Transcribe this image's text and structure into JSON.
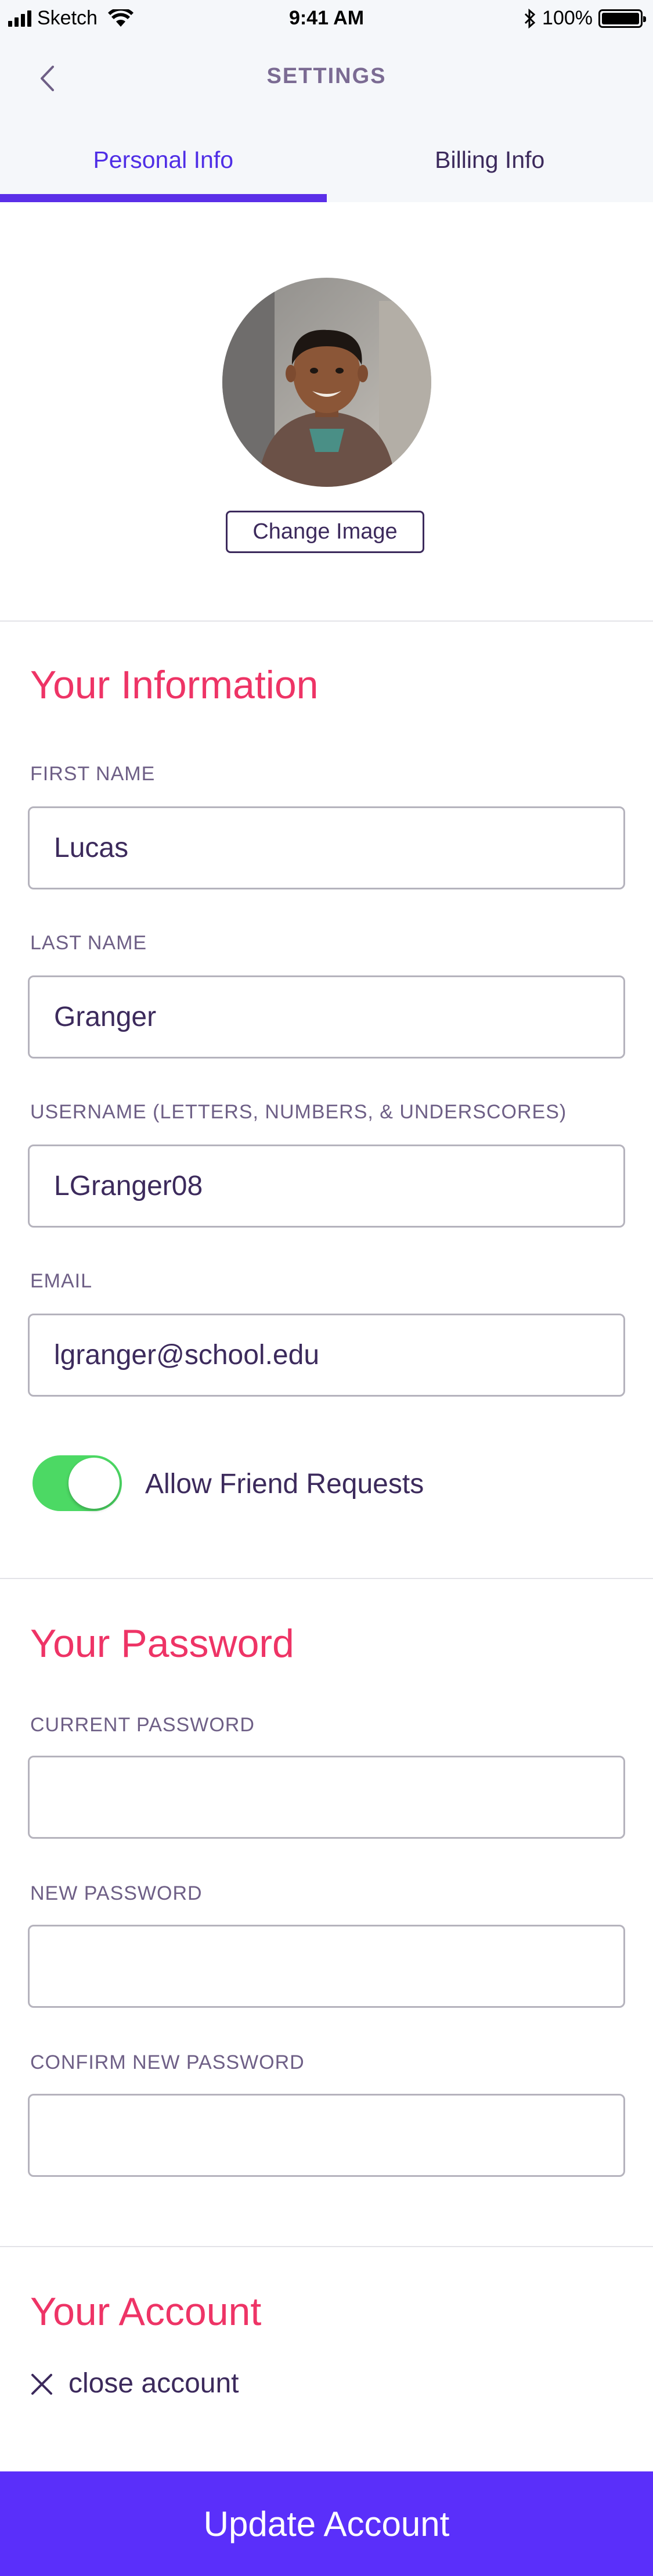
{
  "status_bar": {
    "carrier": "Sketch",
    "time": "9:41 AM",
    "battery": "100%"
  },
  "header": {
    "title": "SETTINGS",
    "back_icon": "chevron-left-icon"
  },
  "tabs": [
    {
      "label": "Personal Info",
      "active": true
    },
    {
      "label": "Billing Info",
      "active": false
    }
  ],
  "profile": {
    "change_image_label": "Change Image"
  },
  "your_information": {
    "title": "Your Information",
    "fields": [
      {
        "label": "FIRST NAME",
        "value": "Lucas"
      },
      {
        "label": "LAST NAME",
        "value": "Granger"
      },
      {
        "label": "USERNAME (LETTERS, NUMBERS, & UNDERSCORES)",
        "value": "LGranger08"
      },
      {
        "label": "EMAIL",
        "value": "lgranger@school.edu"
      }
    ],
    "toggle": {
      "label": "Allow Friend Requests",
      "on": true
    }
  },
  "your_password": {
    "title": "Your Password",
    "fields": [
      {
        "label": "CURRENT PASSWORD",
        "value": ""
      },
      {
        "label": "NEW PASSWORD",
        "value": ""
      },
      {
        "label": "CONFIRM NEW PASSWORD",
        "value": ""
      }
    ]
  },
  "your_account": {
    "title": "Your Account",
    "close_label": "close account"
  },
  "footer": {
    "update_label": "Update Account"
  },
  "colors": {
    "accent": "#5a2ffa",
    "section_title": "#ee3466",
    "toggle_on": "#4cd964",
    "text": "#3c2a5c"
  }
}
